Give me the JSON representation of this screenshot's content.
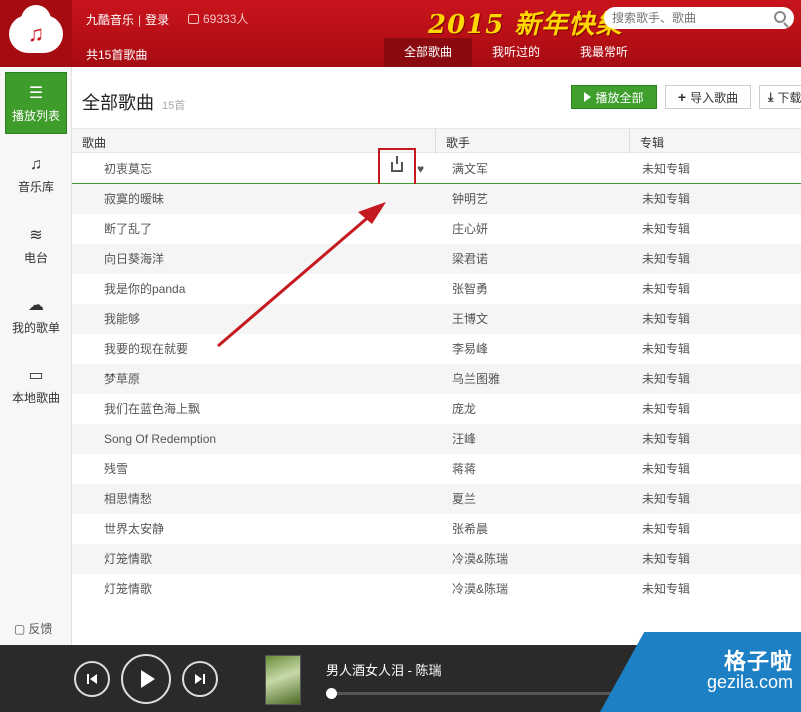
{
  "header": {
    "app_name": "九酷音乐",
    "separator": "|",
    "login": "登录",
    "online_count": "69333人",
    "banner": "2015 新年快樂",
    "search_placeholder": "搜索歌手、歌曲"
  },
  "subbar": {
    "song_count": "共15首歌曲",
    "tabs": [
      {
        "label": "全部歌曲",
        "active": true
      },
      {
        "label": "我听过的",
        "active": false
      },
      {
        "label": "我最常听",
        "active": false
      }
    ]
  },
  "sidebar": {
    "items": [
      {
        "label": "播放列表",
        "icon": "list-icon",
        "active": true
      },
      {
        "label": "音乐库",
        "icon": "music-note-icon"
      },
      {
        "label": "电台",
        "icon": "wifi-icon"
      },
      {
        "label": "我的歌单",
        "icon": "cloud-icon"
      },
      {
        "label": "本地歌曲",
        "icon": "monitor-icon"
      }
    ],
    "feedback": "反馈"
  },
  "main": {
    "title": "全部歌曲",
    "count": "15首",
    "buttons": {
      "play_all": "播放全部",
      "import": "导入歌曲",
      "download": "下载"
    },
    "columns": [
      "歌曲",
      "歌手",
      "专辑"
    ],
    "rows": [
      {
        "song": "初衷莫忘",
        "artist": "满文军",
        "album": "未知专辑"
      },
      {
        "song": "寂寞的暧昧",
        "artist": "钟明艺",
        "album": "未知专辑"
      },
      {
        "song": "断了乱了",
        "artist": "庄心妍",
        "album": "未知专辑"
      },
      {
        "song": "向日葵海洋",
        "artist": "梁君诺",
        "album": "未知专辑"
      },
      {
        "song": "我是你的panda",
        "artist": "张智勇",
        "album": "未知专辑"
      },
      {
        "song": "我能够",
        "artist": "王博文",
        "album": "未知专辑"
      },
      {
        "song": "我要的现在就要",
        "artist": "李易峰",
        "album": "未知专辑"
      },
      {
        "song": "梦草原",
        "artist": "乌兰图雅",
        "album": "未知专辑"
      },
      {
        "song": "我们在蓝色海上飘",
        "artist": "庞龙",
        "album": "未知专辑"
      },
      {
        "song": "Song Of Redemption",
        "artist": "汪峰",
        "album": "未知专辑"
      },
      {
        "song": "残雪",
        "artist": "蒋蒋",
        "album": "未知专辑"
      },
      {
        "song": "相思情愁",
        "artist": "夏兰",
        "album": "未知专辑"
      },
      {
        "song": "世界太安静",
        "artist": "张希晨",
        "album": "未知专辑"
      },
      {
        "song": "灯笼情歌",
        "artist": "冷漠&陈瑞",
        "album": "未知专辑"
      },
      {
        "song": "灯笼情歌",
        "artist": "冷漠&陈瑞",
        "album": "未知专辑"
      }
    ]
  },
  "player": {
    "now_playing": "男人酒女人泪 - 陈瑞",
    "progress": 0
  },
  "watermark": {
    "line1": "格子啦",
    "line2": "gezila.com"
  },
  "colors": {
    "header_red": "#c8141c",
    "accent_green": "#3fa02d",
    "annotation_red": "#c4191f",
    "player_bg": "#2a2a2a"
  }
}
